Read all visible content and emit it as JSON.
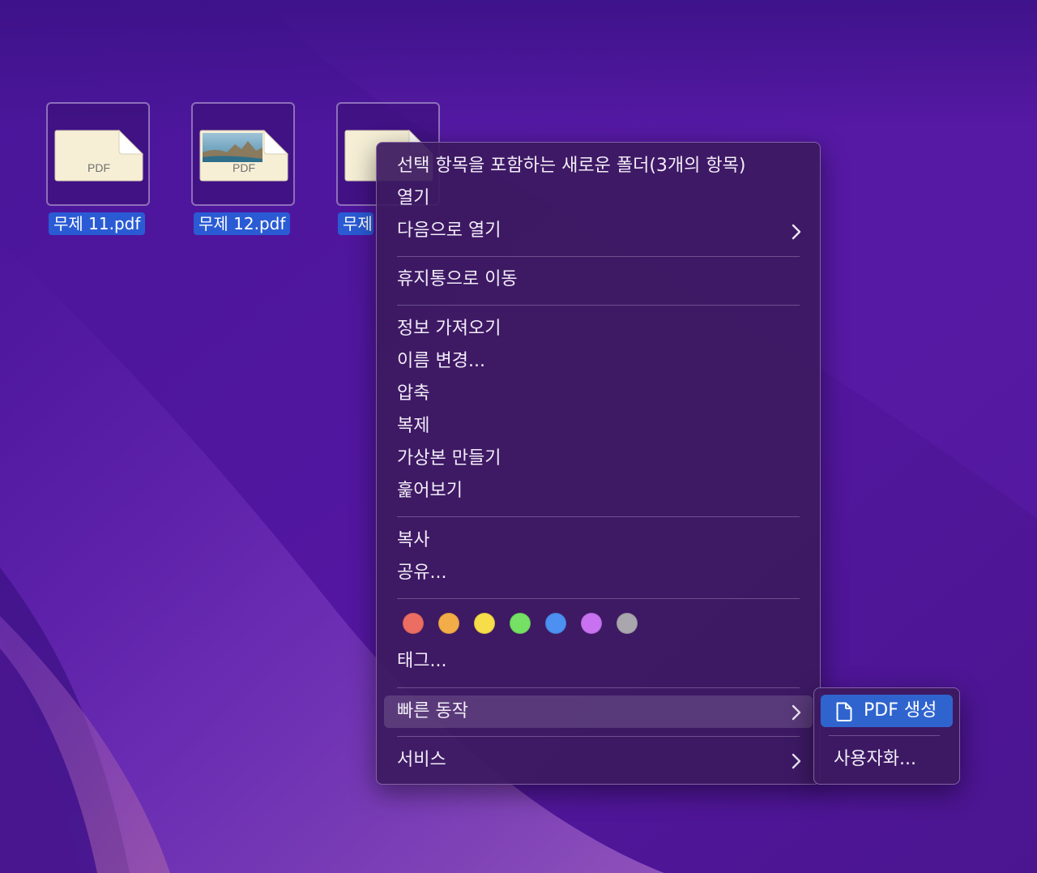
{
  "desktop": {
    "files": [
      {
        "label": "무제 11.pdf",
        "doc_text": "PDF"
      },
      {
        "label": "무제 12.pdf",
        "doc_text": "PDF"
      },
      {
        "label": "무제"
      }
    ]
  },
  "context_menu": {
    "items": [
      {
        "label": "선택 항목을 포함하는 새로운 폴더(3개의 항목)"
      },
      {
        "label": "열기"
      },
      {
        "label": "다음으로 열기",
        "has_submenu": true
      },
      {
        "label": "휴지통으로 이동"
      },
      {
        "label": "정보 가져오기"
      },
      {
        "label": "이름 변경..."
      },
      {
        "label": "압축"
      },
      {
        "label": "복제"
      },
      {
        "label": "가상본 만들기"
      },
      {
        "label": "훑어보기"
      },
      {
        "label": "복사"
      },
      {
        "label": "공유..."
      },
      {
        "label": "태그..."
      },
      {
        "label": "빠른 동작",
        "has_submenu": true,
        "highlighted": true
      },
      {
        "label": "서비스",
        "has_submenu": true
      }
    ],
    "tag_colors": [
      {
        "name": "red",
        "hex": "#ec6e62"
      },
      {
        "name": "orange",
        "hex": "#f3ad48"
      },
      {
        "name": "yellow",
        "hex": "#f7dd4a"
      },
      {
        "name": "green",
        "hex": "#74e064"
      },
      {
        "name": "blue",
        "hex": "#4c90f2"
      },
      {
        "name": "purple",
        "hex": "#c872f2"
      },
      {
        "name": "gray",
        "hex": "#a9a7ad"
      }
    ]
  },
  "quick_actions_submenu": {
    "create_pdf": {
      "label": "PDF 생성",
      "icon": "document-icon"
    },
    "customize": {
      "label": "사용자화..."
    }
  },
  "colors": {
    "selection_label_bg": "#2a5bd4",
    "submenu_highlight": "#2f64cf",
    "desktop_bg": "#4e1896"
  }
}
